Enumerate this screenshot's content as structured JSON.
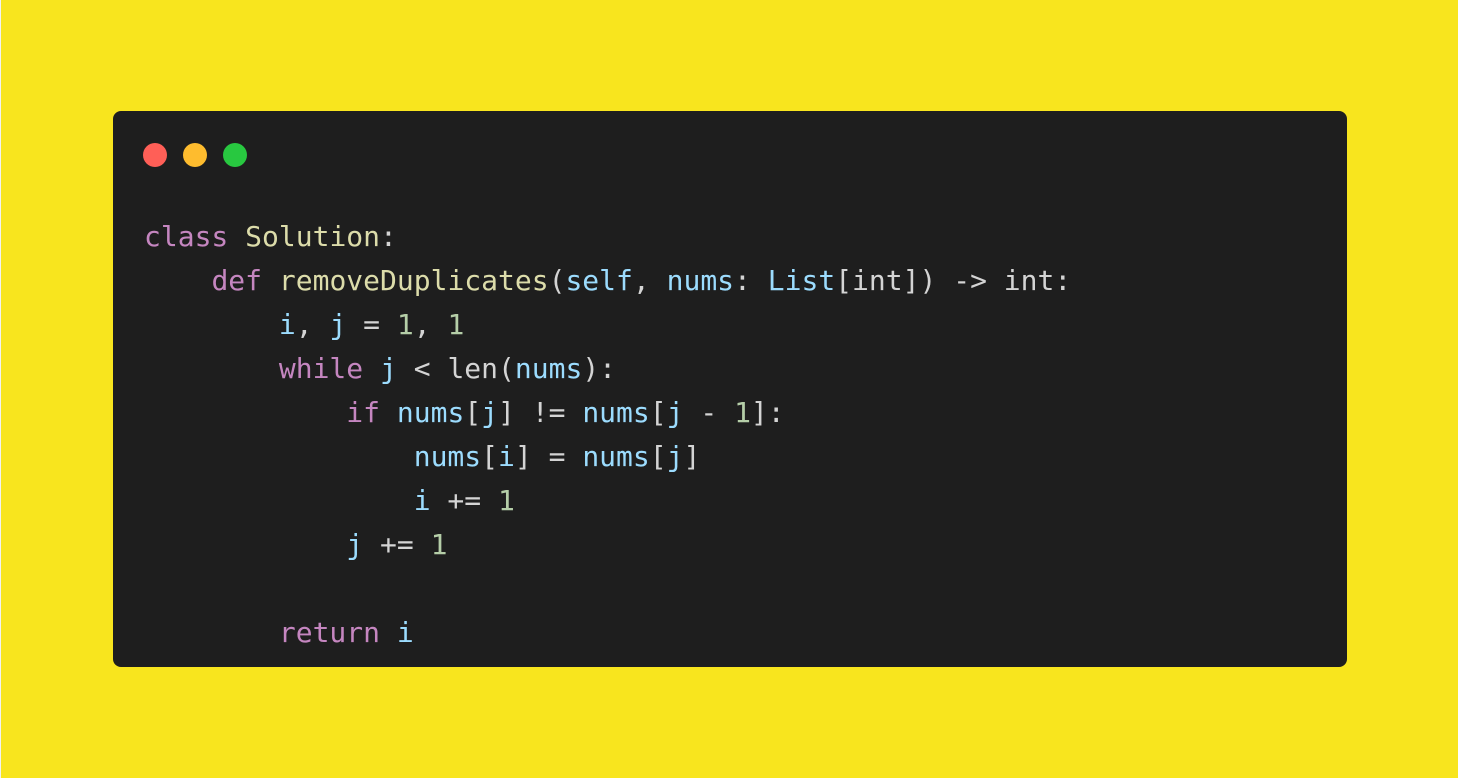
{
  "window": {
    "controls": [
      {
        "name": "close",
        "color": "#ff5f57"
      },
      {
        "name": "minimize",
        "color": "#febc2e"
      },
      {
        "name": "maximize",
        "color": "#28c840"
      }
    ]
  },
  "colors": {
    "background": "#f8e51e",
    "editor": "#1e1e1e",
    "keyword": "#c586c0",
    "function": "#dcdcaa",
    "variable": "#9cdcfe",
    "type": "#4ec9b0",
    "number": "#b5cea8",
    "plain": "#d4d4d4"
  },
  "code": {
    "language": "python",
    "lines": [
      [
        {
          "t": "class",
          "c": "kw"
        },
        {
          "t": " ",
          "c": "plain"
        },
        {
          "t": "Solution",
          "c": "cls"
        },
        {
          "t": ":",
          "c": "plain"
        }
      ],
      [
        {
          "t": "    ",
          "c": "plain"
        },
        {
          "t": "def",
          "c": "kw"
        },
        {
          "t": " ",
          "c": "plain"
        },
        {
          "t": "removeDuplicates",
          "c": "fn"
        },
        {
          "t": "(",
          "c": "plain"
        },
        {
          "t": "self",
          "c": "var"
        },
        {
          "t": ", ",
          "c": "plain"
        },
        {
          "t": "nums",
          "c": "var"
        },
        {
          "t": ": ",
          "c": "plain"
        },
        {
          "t": "List",
          "c": "var"
        },
        {
          "t": "[int]) -> int:",
          "c": "plain"
        }
      ],
      [
        {
          "t": "        ",
          "c": "plain"
        },
        {
          "t": "i",
          "c": "var"
        },
        {
          "t": ", ",
          "c": "plain"
        },
        {
          "t": "j",
          "c": "var"
        },
        {
          "t": " = ",
          "c": "plain"
        },
        {
          "t": "1",
          "c": "num"
        },
        {
          "t": ", ",
          "c": "plain"
        },
        {
          "t": "1",
          "c": "num"
        }
      ],
      [
        {
          "t": "        ",
          "c": "plain"
        },
        {
          "t": "while",
          "c": "kw"
        },
        {
          "t": " ",
          "c": "plain"
        },
        {
          "t": "j",
          "c": "var"
        },
        {
          "t": " < ",
          "c": "plain"
        },
        {
          "t": "len",
          "c": "plain"
        },
        {
          "t": "(",
          "c": "plain"
        },
        {
          "t": "nums",
          "c": "var"
        },
        {
          "t": "):",
          "c": "plain"
        }
      ],
      [
        {
          "t": "            ",
          "c": "plain"
        },
        {
          "t": "if",
          "c": "kw"
        },
        {
          "t": " ",
          "c": "plain"
        },
        {
          "t": "nums",
          "c": "var"
        },
        {
          "t": "[",
          "c": "plain"
        },
        {
          "t": "j",
          "c": "var"
        },
        {
          "t": "] != ",
          "c": "plain"
        },
        {
          "t": "nums",
          "c": "var"
        },
        {
          "t": "[",
          "c": "plain"
        },
        {
          "t": "j",
          "c": "var"
        },
        {
          "t": " - ",
          "c": "plain"
        },
        {
          "t": "1",
          "c": "num"
        },
        {
          "t": "]:",
          "c": "plain"
        }
      ],
      [
        {
          "t": "                ",
          "c": "plain"
        },
        {
          "t": "nums",
          "c": "var"
        },
        {
          "t": "[",
          "c": "plain"
        },
        {
          "t": "i",
          "c": "var"
        },
        {
          "t": "] = ",
          "c": "plain"
        },
        {
          "t": "nums",
          "c": "var"
        },
        {
          "t": "[",
          "c": "plain"
        },
        {
          "t": "j",
          "c": "var"
        },
        {
          "t": "]",
          "c": "plain"
        }
      ],
      [
        {
          "t": "                ",
          "c": "plain"
        },
        {
          "t": "i",
          "c": "var"
        },
        {
          "t": " += ",
          "c": "plain"
        },
        {
          "t": "1",
          "c": "num"
        }
      ],
      [
        {
          "t": "            ",
          "c": "plain"
        },
        {
          "t": "j",
          "c": "var"
        },
        {
          "t": " += ",
          "c": "plain"
        },
        {
          "t": "1",
          "c": "num"
        }
      ],
      [],
      [
        {
          "t": "        ",
          "c": "plain"
        },
        {
          "t": "return",
          "c": "kw"
        },
        {
          "t": " ",
          "c": "plain"
        },
        {
          "t": "i",
          "c": "var"
        }
      ]
    ]
  }
}
